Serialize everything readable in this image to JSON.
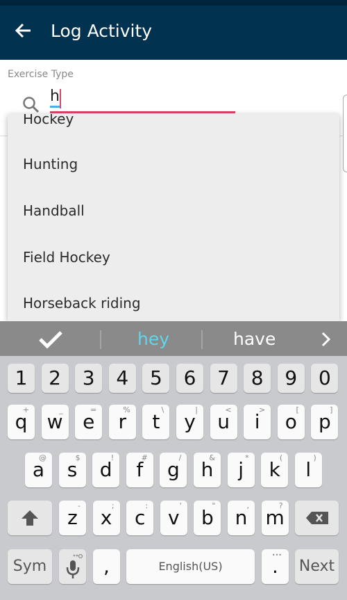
{
  "app": {
    "title": "Log Activity",
    "back_icon": "arrow-left-icon"
  },
  "form": {
    "label": "Exercise Type",
    "search_icon": "search-icon",
    "input_value": "h"
  },
  "dropdown": {
    "items": [
      "Hockey",
      "Hunting",
      "Handball",
      "Field Hockey",
      "Horseback riding"
    ]
  },
  "keyboard": {
    "suggestions": {
      "accept_icon": "checkmark-icon",
      "words": [
        "hey",
        "have"
      ],
      "highlight_color": "#5fd6ea",
      "more_icon": "chevron-right-icon"
    },
    "number_row": [
      "1",
      "2",
      "3",
      "4",
      "5",
      "6",
      "7",
      "8",
      "9",
      "0"
    ],
    "row1": [
      {
        "k": "q",
        "h": "+"
      },
      {
        "k": "w",
        "h": "_"
      },
      {
        "k": "e",
        "h": "="
      },
      {
        "k": "r",
        "h": "%"
      },
      {
        "k": "t",
        "h": "\\"
      },
      {
        "k": "y",
        "h": "|"
      },
      {
        "k": "u",
        "h": "<"
      },
      {
        "k": "i",
        "h": ">"
      },
      {
        "k": "o",
        "h": "["
      },
      {
        "k": "p",
        "h": "]"
      }
    ],
    "row2": [
      {
        "k": "a",
        "h": "@"
      },
      {
        "k": "s",
        "h": "$"
      },
      {
        "k": "d",
        "h": "!"
      },
      {
        "k": "f",
        "h": "#"
      },
      {
        "k": "g",
        "h": "/"
      },
      {
        "k": "h",
        "h": "&"
      },
      {
        "k": "j",
        "h": "*"
      },
      {
        "k": "k",
        "h": "("
      },
      {
        "k": "l",
        "h": ")"
      }
    ],
    "row3": [
      {
        "k": "z",
        "h": "-"
      },
      {
        "k": "x",
        "h": ";"
      },
      {
        "k": "c",
        "h": ":"
      },
      {
        "k": "v",
        "h": "'"
      },
      {
        "k": "b",
        "h": "\""
      },
      {
        "k": "n",
        "h": ","
      },
      {
        "k": "m",
        "h": "?"
      }
    ],
    "shift_icon": "shift-arrow-icon",
    "backspace_icon": "backspace-icon",
    "sym_label": "Sym",
    "mic_icon": "microphone-icon",
    "comma": ",",
    "space_label": "English(US)",
    "period": ".",
    "next_label": "Next"
  },
  "colors": {
    "appbar": "#01324f",
    "accent": "#d9456b"
  }
}
